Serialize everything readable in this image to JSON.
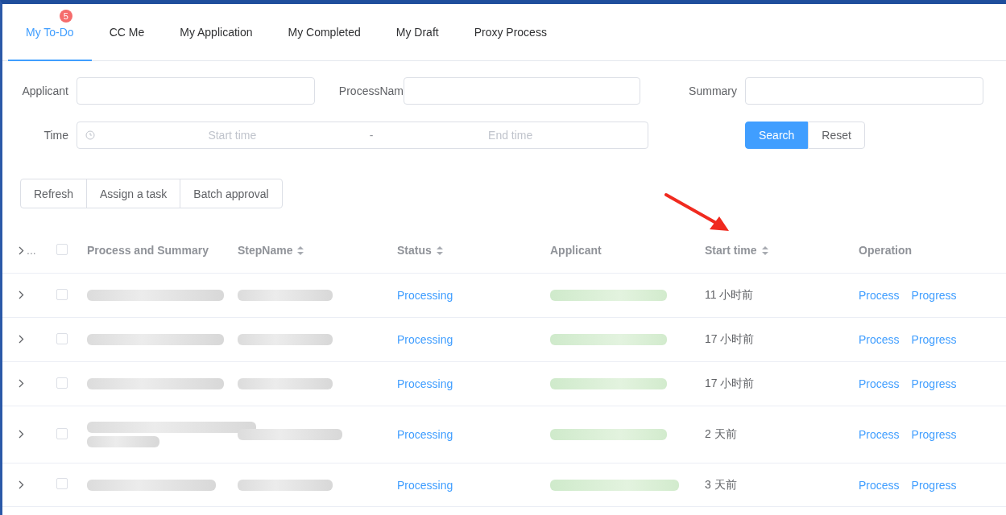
{
  "tabs": [
    {
      "label": "My To-Do",
      "selected": true,
      "badge": "5"
    },
    {
      "label": "CC Me",
      "selected": false
    },
    {
      "label": "My Application",
      "selected": false
    },
    {
      "label": "My Completed",
      "selected": false
    },
    {
      "label": "My Draft",
      "selected": false
    },
    {
      "label": "Proxy Process",
      "selected": false
    }
  ],
  "filters": {
    "applicant": {
      "label": "Applicant"
    },
    "process_name": {
      "label": "ProcessNam"
    },
    "summary": {
      "label": "Summary"
    },
    "time": {
      "label": "Time",
      "start_placeholder": "Start time",
      "separator": "-",
      "end_placeholder": "End time"
    },
    "buttons": [
      {
        "label": "Search",
        "kind": "primary"
      },
      {
        "label": "Reset",
        "kind": "default"
      }
    ]
  },
  "toolbar": [
    "Refresh",
    "Assign a task",
    "Batch approval"
  ],
  "table": {
    "expand_header": "...",
    "header_checked": false,
    "columns": [
      {
        "label": "Process and Summary",
        "sortable": false
      },
      {
        "label": "StepName",
        "sortable": true
      },
      {
        "label": "Status",
        "sortable": true
      },
      {
        "label": "Applicant",
        "sortable": false
      },
      {
        "label": "Start time",
        "sortable": true
      },
      {
        "label": "Operation",
        "sortable": false
      }
    ],
    "rows": [
      {
        "checked": false,
        "status": "Processing",
        "start_time": "11 小时前",
        "actions": [
          "Process",
          "Progress"
        ]
      },
      {
        "checked": false,
        "status": "Processing",
        "start_time": "17 小时前",
        "actions": [
          "Process",
          "Progress"
        ]
      },
      {
        "checked": false,
        "status": "Processing",
        "start_time": "17 小时前",
        "actions": [
          "Process",
          "Progress"
        ]
      },
      {
        "checked": false,
        "status": "Processing",
        "start_time": "2 天前",
        "actions": [
          "Process",
          "Progress"
        ]
      },
      {
        "checked": false,
        "status": "Processing",
        "start_time": "3 天前",
        "actions": [
          "Process",
          "Progress"
        ]
      }
    ]
  }
}
